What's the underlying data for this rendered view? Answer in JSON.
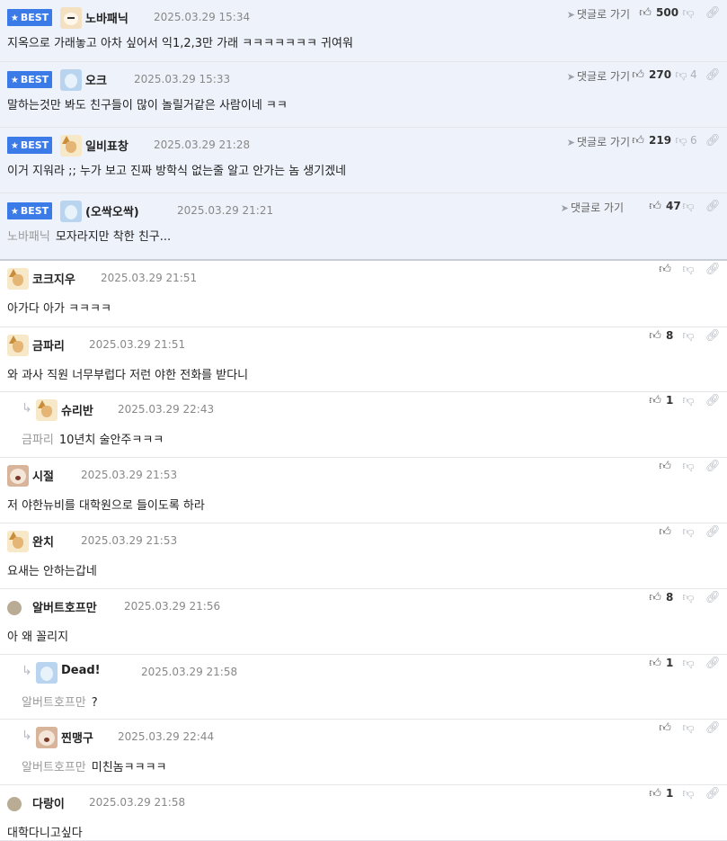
{
  "best_badge": "BEST",
  "goto_label": "댓글로 가기",
  "comments": [
    {
      "best": true,
      "avatar": "dog",
      "nick": "노바패닉",
      "date": "2025.03.29 15:34",
      "text": "지옥으로 가래놓고 아차 싶어서 익1,2,3만 가래 ㅋㅋㅋㅋㅋㅋㅋ 귀여워",
      "up": "500",
      "down": ""
    },
    {
      "best": true,
      "avatar": "blue",
      "nick": "오크",
      "date": "2025.03.29 15:33",
      "text": "말하는것만 봐도 친구들이 많이 놀릴거같은 사람이네 ㅋㅋ",
      "up": "270",
      "down": "4"
    },
    {
      "best": true,
      "avatar": "fox",
      "nick": "일비표창",
      "date": "2025.03.29 21:28",
      "text": "이거 지워라 ;; 누가 보고 진짜 방학식 없는줄 알고 안가는 놈 생기겠네",
      "up": "219",
      "down": "6"
    },
    {
      "best": true,
      "avatar": "blue",
      "nick": "(오싹오싹)",
      "date": "2025.03.29 21:21",
      "quote": "노바패닉",
      "text": "모자라지만 착한 친구...",
      "up": "47",
      "down": ""
    },
    {
      "avatar": "fox",
      "nick": "코크지우",
      "date": "2025.03.29 21:51",
      "text": "아가다 아가 ㅋㅋㅋㅋ",
      "up": "",
      "down": ""
    },
    {
      "avatar": "fox",
      "nick": "금파리",
      "date": "2025.03.29 21:51",
      "text": "와 과사 직원 너무부럽다 저런 야한 전화를 받다니",
      "up": "8",
      "down": ""
    },
    {
      "reply": true,
      "avatar": "fox",
      "nick": "슈리반",
      "date": "2025.03.29 22:43",
      "quote": "금파리",
      "text": "10년치 술안주ㅋㅋㅋ",
      "up": "1",
      "down": ""
    },
    {
      "avatar": "pup",
      "nick": "시절",
      "date": "2025.03.29 21:53",
      "text": "저 야한뉴비를 대학원으로 들이도록 하라",
      "up": "",
      "down": ""
    },
    {
      "avatar": "fox",
      "nick": "완치",
      "date": "2025.03.29 21:53",
      "text": "요새는 안하는갑네",
      "up": "",
      "down": ""
    },
    {
      "avatar": "dot",
      "nick": "알버트호프만",
      "date": "2025.03.29 21:56",
      "text": "아 왜 꼴리지",
      "up": "8",
      "down": ""
    },
    {
      "reply": true,
      "avatar": "blue",
      "nick": "Dead!",
      "date": "2025.03.29 21:58",
      "quote": "알버트호프만",
      "text": "?",
      "up": "1",
      "down": ""
    },
    {
      "reply": true,
      "avatar": "pup",
      "nick": "찐맹구",
      "date": "2025.03.29 22:44",
      "quote": "알버트호프만",
      "text": "미친놈ㅋㅋㅋㅋ",
      "up": "",
      "down": ""
    },
    {
      "avatar": "dot",
      "nick": "다랑이",
      "date": "2025.03.29 21:58",
      "text": "대학다니고싶다",
      "up": "1",
      "down": ""
    }
  ]
}
